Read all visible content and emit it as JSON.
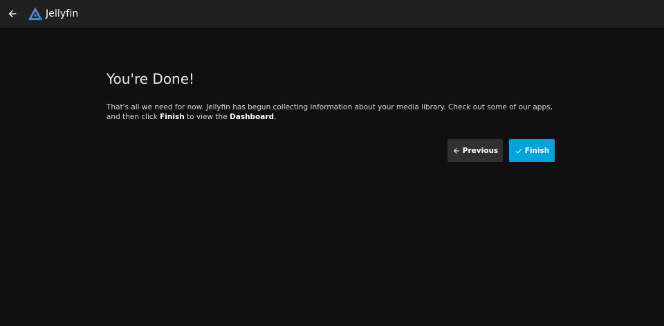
{
  "header": {
    "back_icon": "arrow-left-icon",
    "app_name": "Jellyfin",
    "logo_icon": "jellyfin-logo-icon"
  },
  "main": {
    "title": "You're Done!",
    "description": {
      "part1": "That's all we need for now. Jellyfin has begun collecting information about your media library. Check out some of our apps, and then click ",
      "finish_word": "Finish",
      "part2": " to view the ",
      "dashboard_word": "Dashboard",
      "part3": "."
    }
  },
  "actions": {
    "previous_label": "Previous",
    "previous_icon": "arrow-left-icon",
    "finish_label": "Finish",
    "finish_icon": "check-icon"
  },
  "colors": {
    "background": "#101010",
    "header": "#202020",
    "accent": "#00a4dc",
    "secondary_button": "#303030"
  }
}
